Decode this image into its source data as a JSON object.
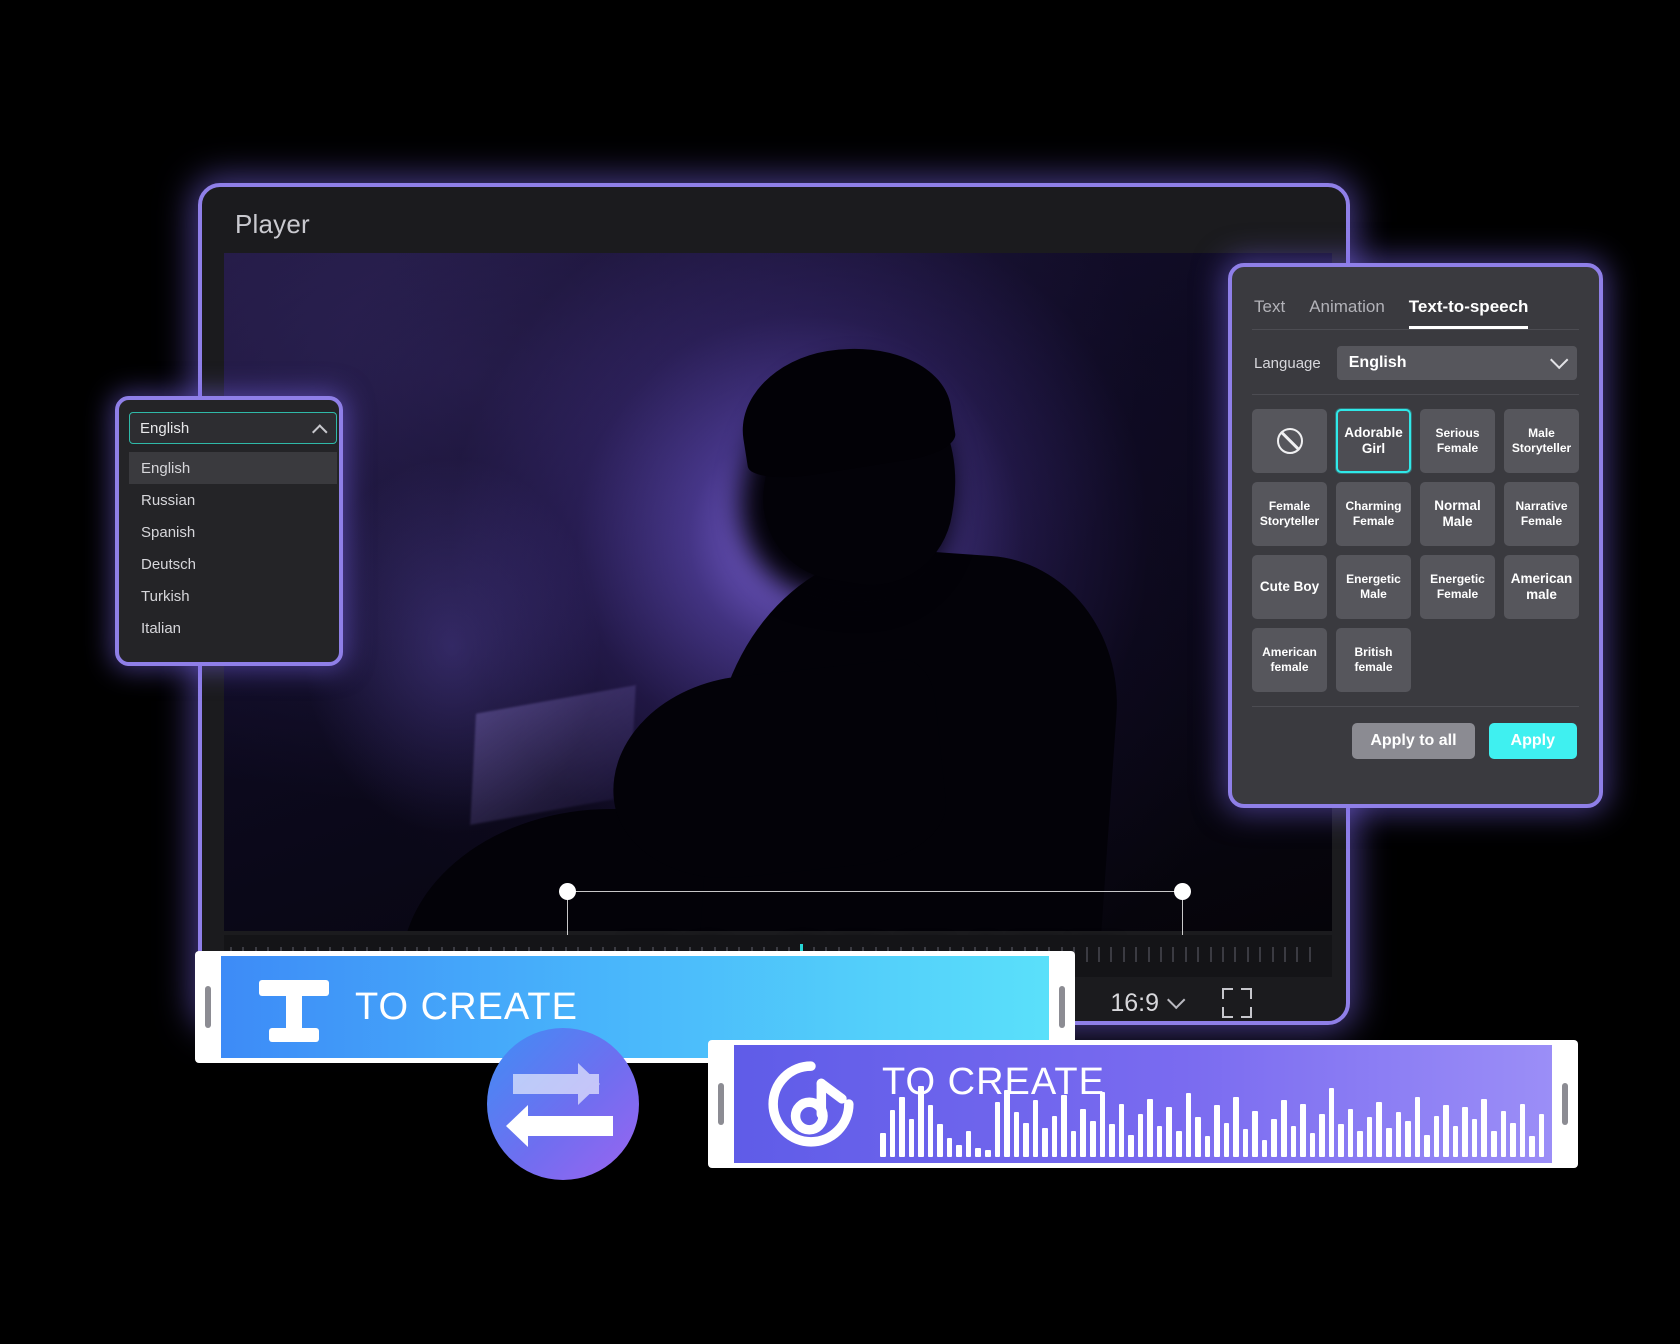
{
  "player": {
    "title": "Player",
    "overlay_text": "TO CREATE",
    "aspect_ratio": "16:9",
    "ratio_chevron_icon": "chevron-down-icon",
    "fullscreen_icon": "fullscreen-icon"
  },
  "language_popup": {
    "selected": "English",
    "chevron_icon": "chevron-up-icon",
    "options": [
      "English",
      "Russian",
      "Spanish",
      "Deutsch",
      "Turkish",
      "Italian"
    ]
  },
  "tts_panel": {
    "tabs": [
      {
        "label": "Text",
        "active": false
      },
      {
        "label": "Animation",
        "active": false
      },
      {
        "label": "Text-to-speech",
        "active": true
      }
    ],
    "language_label": "Language",
    "language_value": "English",
    "language_chevron_icon": "chevron-down-icon",
    "voices": [
      {
        "label": "",
        "icon": "no-voice-icon",
        "selected": false
      },
      {
        "label": "Adorable Girl",
        "icon": null,
        "selected": true
      },
      {
        "label": "Serious Female",
        "icon": null,
        "selected": false
      },
      {
        "label": "Male Storyteller",
        "icon": null,
        "selected": false
      },
      {
        "label": "Female Storyteller",
        "icon": null,
        "selected": false
      },
      {
        "label": "Charming Female",
        "icon": null,
        "selected": false
      },
      {
        "label": "Normal Male",
        "icon": null,
        "selected": false
      },
      {
        "label": "Narrative Female",
        "icon": null,
        "selected": false
      },
      {
        "label": "Cute Boy",
        "icon": null,
        "selected": false
      },
      {
        "label": "Energetic Male",
        "icon": null,
        "selected": false
      },
      {
        "label": "Energetic Female",
        "icon": null,
        "selected": false
      },
      {
        "label": "American male",
        "icon": null,
        "selected": false
      },
      {
        "label": "American female",
        "icon": null,
        "selected": false
      },
      {
        "label": "British female",
        "icon": null,
        "selected": false
      }
    ],
    "apply_to_all_label": "Apply to all",
    "apply_label": "Apply"
  },
  "timeline": {
    "text_clip": {
      "label": "TO CREATE",
      "icon": "text-t-icon"
    },
    "audio_clip": {
      "label": "TO CREATE",
      "icon": "music-note-icon"
    },
    "swap_badge_icon": "swap-arrows-icon",
    "playhead_position_pct": 52
  },
  "colors": {
    "accent_purple": "#8f7fe8",
    "accent_cyan": "#3ff0f0",
    "teal_border": "#2fb9a8",
    "panel_bg": "#3a3a3f",
    "window_bg": "#1b1b1e",
    "clip_text_gradient_start": "#3d8bf7",
    "clip_text_gradient_end": "#5ae0fa",
    "clip_audio_gradient_start": "#5f5ce8",
    "clip_audio_gradient_end": "#9b8ef7"
  }
}
